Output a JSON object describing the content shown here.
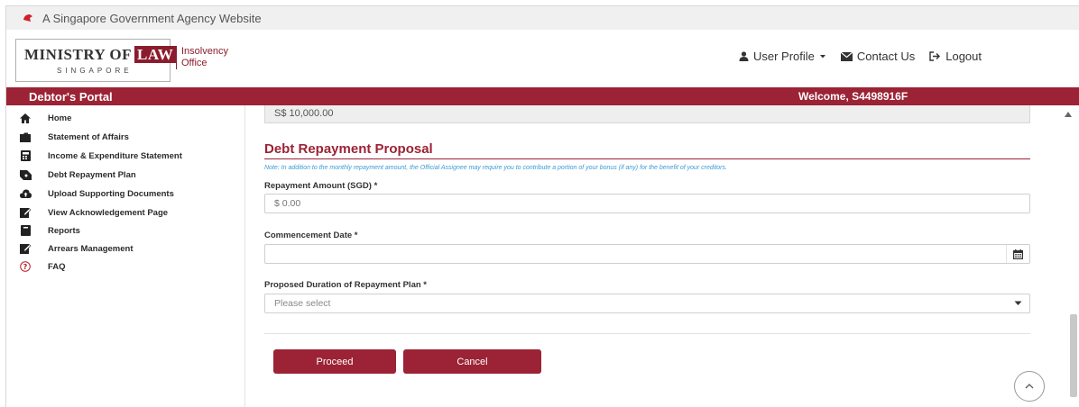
{
  "masthead": {
    "text": "A Singapore Government Agency Website"
  },
  "logo": {
    "main_prefix": "MINISTRY OF",
    "main_highlight": "LAW",
    "subtitle": "SINGAPORE",
    "side_text": "Insolvency\nOffice"
  },
  "header_nav": {
    "user_profile": "User Profile",
    "contact_us": "Contact Us",
    "logout": "Logout"
  },
  "portal_bar": {
    "title": "Debtor's Portal",
    "welcome": "Welcome, S4498916F"
  },
  "sidebar": {
    "items": [
      {
        "label": "Home",
        "icon": "home-icon"
      },
      {
        "label": "Statement of Affairs",
        "icon": "folder-icon"
      },
      {
        "label": "Income & Expenditure Statement",
        "icon": "calculator-icon"
      },
      {
        "label": "Debt Repayment Plan",
        "icon": "money-icon"
      },
      {
        "label": "Upload Supporting Documents",
        "icon": "cloud-upload-icon"
      },
      {
        "label": "View Acknowledgement Page",
        "icon": "edit-document-icon"
      },
      {
        "label": "Reports",
        "icon": "book-icon"
      },
      {
        "label": "Arrears Management",
        "icon": "edit-document-icon"
      },
      {
        "label": "FAQ",
        "icon": "question-circle-icon"
      }
    ]
  },
  "form": {
    "previous_field_value": "S$ 10,000.00",
    "section_title": "Debt Repayment Proposal",
    "note": "Note: In addition to the monthly repayment amount, the Official Assignee may require you to contribute a portion of your bonus (if any) for the benefit of your creditors.",
    "repayment_amount": {
      "label": "Repayment Amount (SGD) *",
      "placeholder": "$ 0.00",
      "value": ""
    },
    "commencement_date": {
      "label": "Commencement Date *",
      "value": ""
    },
    "duration": {
      "label": "Proposed Duration of Repayment Plan *",
      "selected": "Please select"
    },
    "proceed_label": "Proceed",
    "cancel_label": "Cancel"
  },
  "colors": {
    "brand_maroon": "#9b2335",
    "note_blue": "#3a9bd5",
    "masthead_gray": "#f0f0f0"
  }
}
